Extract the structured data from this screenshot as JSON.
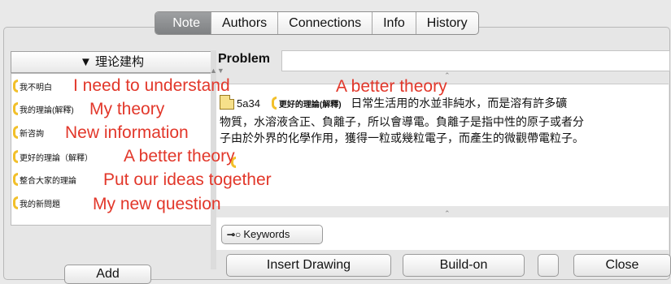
{
  "tabs": [
    {
      "label": "Note",
      "active": true
    },
    {
      "label": "Authors",
      "active": false
    },
    {
      "label": "Connections",
      "active": false
    },
    {
      "label": "Info",
      "active": false
    },
    {
      "label": "History",
      "active": false
    }
  ],
  "scaffold_panel": {
    "header": "▼ 理论建构",
    "items": [
      {
        "label": "我不明白"
      },
      {
        "label": "我的理論(解釋)"
      },
      {
        "label": "新咨詢"
      },
      {
        "label": "更好的理論（解釋）"
      },
      {
        "label": "整合大家的理論"
      },
      {
        "label": "我的新問題"
      }
    ],
    "add_button": "Add"
  },
  "problem": {
    "label": "Problem",
    "value": ""
  },
  "content": {
    "note_id": "5a34",
    "scaffold_tag": "更好的理論(解釋)",
    "line1": "日常生活用的水並非純水，而是溶有許多礦",
    "line2": "物質，水溶液含正、負離子，所以會導電。負離子是指中性的原子或者分",
    "line3": "子由於外界的化學作用，獲得一粒或幾粒電子，而產生的微觀帶電粒子。"
  },
  "keywords_button": "Keywords",
  "buttons": {
    "insert_drawing": "Insert Drawing",
    "build_on": "Build-on",
    "close": "Close"
  },
  "annotations": [
    "I need to understand",
    "My theory",
    "New information",
    "A better theory",
    "Put our ideas together",
    "My new question",
    "A better theory"
  ],
  "colors": {
    "annotation": "#e2372a",
    "scaffold_paren": "#f2c02a",
    "active_tab": "#8a8c8e"
  }
}
